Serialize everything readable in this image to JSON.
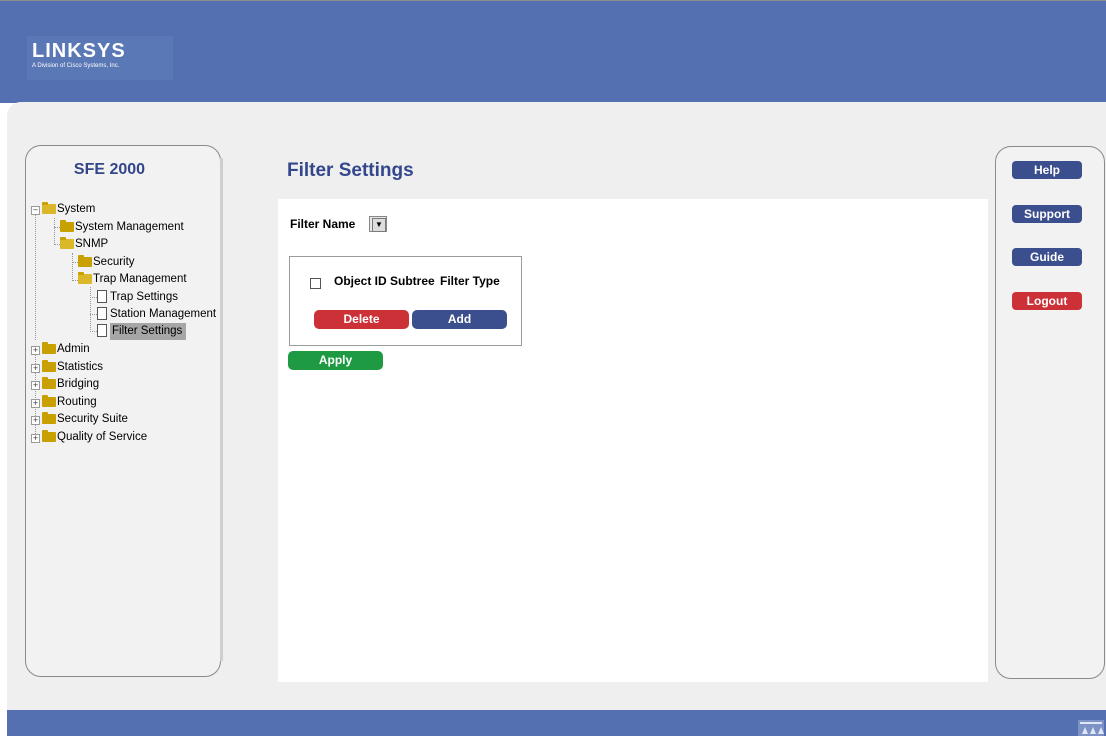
{
  "brand": {
    "name": "LINKSYS",
    "tagline": "A Division of Cisco Systems, Inc."
  },
  "model": "SFE 2000",
  "page_title": "Filter Settings",
  "filter": {
    "label": "Filter Name",
    "selected": ""
  },
  "table": {
    "columns": [
      "Object ID Subtree",
      "Filter Type"
    ]
  },
  "buttons": {
    "delete": "Delete",
    "add": "Add",
    "apply": "Apply"
  },
  "right_nav": {
    "help": "Help",
    "support": "Support",
    "guide": "Guide",
    "logout": "Logout"
  },
  "tree": {
    "system": "System",
    "system_management": "System Management",
    "snmp": "SNMP",
    "security": "Security",
    "trap_management": "Trap Management",
    "trap_settings": "Trap Settings",
    "station_management": "Station Management",
    "filter_settings": "Filter Settings",
    "admin": "Admin",
    "statistics": "Statistics",
    "bridging": "Bridging",
    "routing": "Routing",
    "security_suite": "Security Suite",
    "qos": "Quality of Service"
  },
  "colors": {
    "header": "#5470b0",
    "title": "#34478c",
    "danger": "#cd3138",
    "primary": "#3b4e8d",
    "success": "#1e9b42"
  }
}
